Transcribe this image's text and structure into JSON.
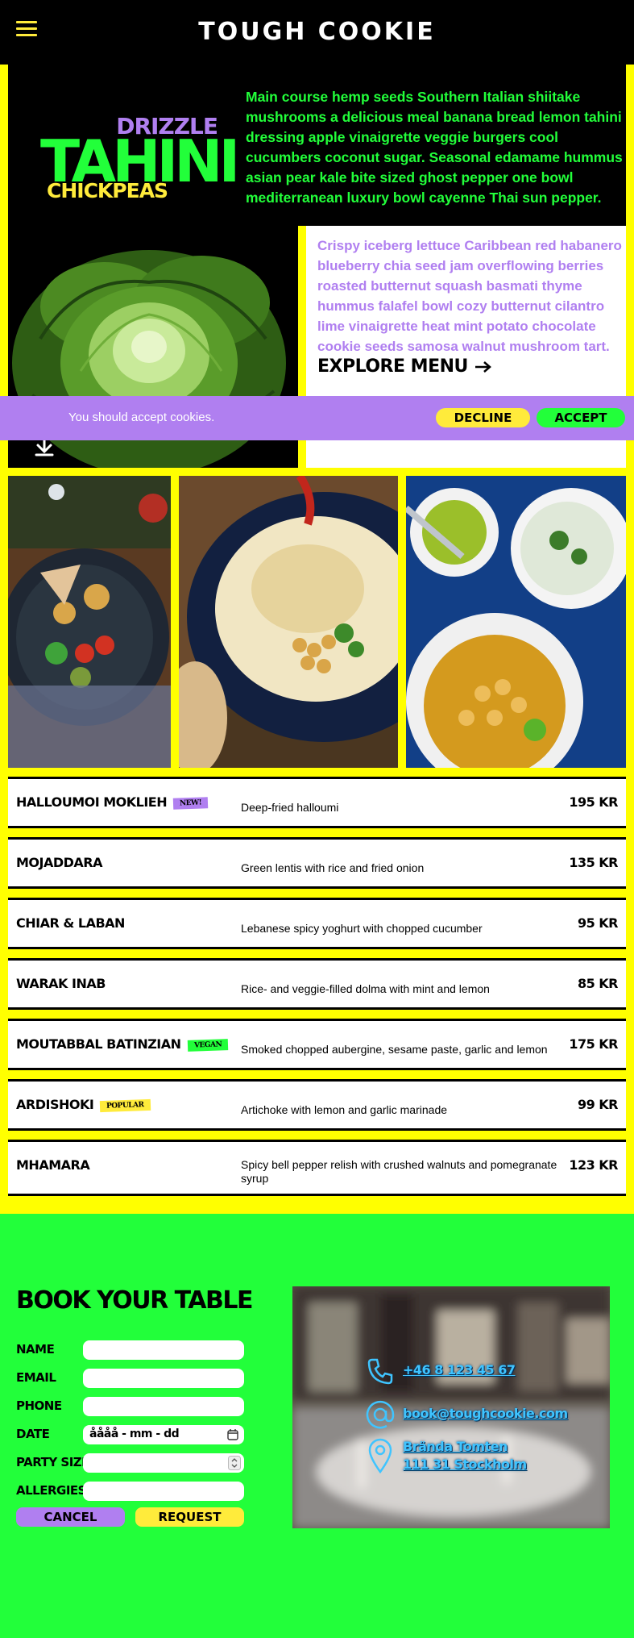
{
  "header": {
    "brand": "TOUGH COOKIE",
    "menu_icon": "hamburger-menu-icon"
  },
  "hero": {
    "word_drizzle": "DRIZZLE",
    "word_tahini": "TAHINI",
    "word_chickpeas": "CHICKPEAS",
    "intro": "Main course hemp seeds Southern Italian shiitake mushrooms a delicious meal banana bread lemon tahini dressing apple vinaigrette veggie burgers cool cucumbers coconut sugar. Seasonal edamame hummus asian pear kale bite sized ghost pepper one bowl mediterranean luxury bowl cayenne Thai sun pepper.",
    "card_text": "Crispy iceberg lettuce Caribbean red habanero blueberry chia seed jam overflowing berries roasted butternut squash basmati thyme hummus falafel bowl cozy butternut cilantro lime vinaigrette heat mint potato chocolate cookie seeds samosa walnut mushroom tart.",
    "explore_label": "EXPLORE MENU",
    "explore_icon": "arrow-right-icon",
    "scroll_icon": "arrow-down-circle-icon"
  },
  "cookie_bar": {
    "message": "You should accept cookies.",
    "decline_label": "DECLINE",
    "accept_label": "ACCEPT"
  },
  "menu": [
    {
      "name": "HALLOUMOI MOKLIEH",
      "badge": "NEW!",
      "badge_color": "#b07ff0",
      "description": "Deep-fried halloumi",
      "price": "195 KR"
    },
    {
      "name": "MOJADDARA",
      "badge": "",
      "description": "Green lentis with rice and fried onion",
      "price": "135 KR"
    },
    {
      "name": "CHIAR & LABAN",
      "badge": "",
      "description": "Lebanese spicy yoghurt with chopped cucumber",
      "price": "95 KR"
    },
    {
      "name": "WARAK INAB",
      "badge": "",
      "description": "Rice- and veggie-filled dolma with mint and lemon",
      "price": "85 KR"
    },
    {
      "name": "MOUTABBAL BATINZIAN",
      "badge": "VEGAN",
      "badge_color": "#22ff3a",
      "description": "Smoked chopped aubergine, sesame paste, garlic and lemon",
      "price": "175 KR"
    },
    {
      "name": "ARDISHOKI",
      "badge": "POPULAR",
      "badge_color": "#ffeb3b",
      "description": "Artichoke with lemon and garlic marinade",
      "price": "99 KR"
    },
    {
      "name": "MHAMARA",
      "badge": "",
      "description": "Spicy bell pepper relish with crushed walnuts and pomegranate syrup",
      "price": "123 KR"
    }
  ],
  "booking": {
    "title": "BOOK YOUR TABLE",
    "labels": {
      "name": "NAME",
      "email": "EMAIL",
      "phone": "PHONE",
      "date": "DATE",
      "party_size": "PARTY SIZE",
      "allergies": "ALLERGIES"
    },
    "date_value": "åååå - mm - dd",
    "cancel_label": "CANCEL",
    "request_label": "REQUEST"
  },
  "contact": {
    "phone": "+46 8 123 45 67",
    "email": "book@toughcookie.com",
    "address_line1": "Brända Tomten",
    "address_line2": "111 31 Stockholm",
    "phone_icon": "phone-icon",
    "email_icon": "at-sign-icon",
    "location_icon": "map-pin-icon"
  },
  "colors": {
    "black": "#000000",
    "yellow": "#ffff00",
    "green": "#22ff3a",
    "purple": "#b07ff0",
    "contact_blue": "#3fc4ff"
  }
}
